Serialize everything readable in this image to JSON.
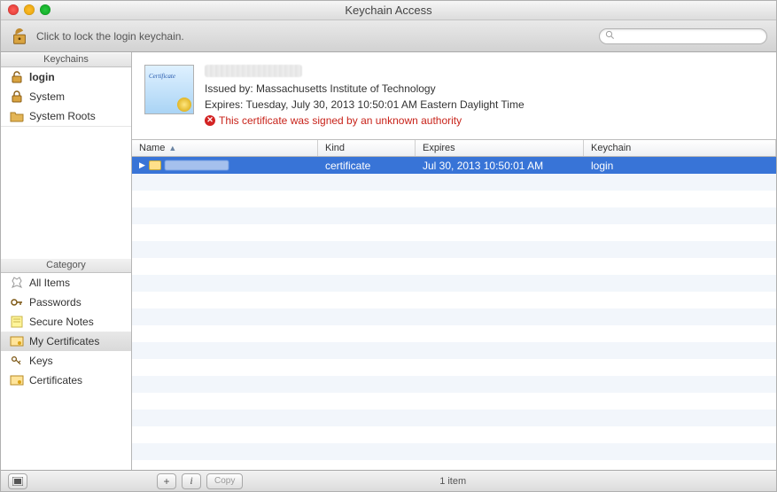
{
  "window": {
    "title": "Keychain Access"
  },
  "toolbar": {
    "lock_hint": "Click to lock the login keychain.",
    "search_placeholder": ""
  },
  "sidebar": {
    "keychains_label": "Keychains",
    "category_label": "Category",
    "keychains": [
      {
        "label": "login",
        "icon": "padlock-open-icon",
        "bold": true
      },
      {
        "label": "System",
        "icon": "padlock-closed-icon"
      },
      {
        "label": "System Roots",
        "icon": "folder-icon"
      }
    ],
    "categories": [
      {
        "label": "All Items",
        "icon": "all-items-icon"
      },
      {
        "label": "Passwords",
        "icon": "key-icon"
      },
      {
        "label": "Secure Notes",
        "icon": "note-icon"
      },
      {
        "label": "My Certificates",
        "icon": "certificate-icon",
        "selected": true
      },
      {
        "label": "Keys",
        "icon": "keys-icon"
      },
      {
        "label": "Certificates",
        "icon": "certificate-icon"
      }
    ]
  },
  "detail": {
    "issued_by": "Issued by: Massachusetts Institute of Technology",
    "expires": "Expires: Tuesday, July 30, 2013 10:50:01 AM Eastern Daylight Time",
    "warning": "This certificate was signed by an unknown authority"
  },
  "table": {
    "columns": {
      "name": "Name",
      "kind": "Kind",
      "expires": "Expires",
      "keychain": "Keychain"
    },
    "rows": [
      {
        "kind": "certificate",
        "expires": "Jul 30, 2013 10:50:01 AM",
        "keychain": "login"
      }
    ]
  },
  "bottombar": {
    "copy_label": "Copy",
    "status": "1 item"
  }
}
